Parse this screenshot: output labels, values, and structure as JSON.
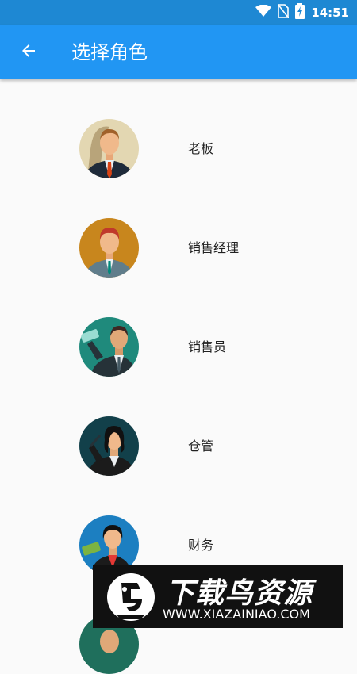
{
  "status_bar": {
    "time": "14:51",
    "icons": [
      "wifi-icon",
      "no-sim-icon",
      "battery-charging-icon"
    ]
  },
  "app_bar": {
    "title": "选择角色",
    "back_icon": "arrow-left-icon"
  },
  "roles": [
    {
      "label": "老板",
      "avatar": "boss-avatar",
      "bg": "#e3d7b2"
    },
    {
      "label": "销售经理",
      "avatar": "sales-manager-avatar",
      "bg": "#c8861d"
    },
    {
      "label": "销售员",
      "avatar": "salesperson-avatar",
      "bg": "#1f8a7c"
    },
    {
      "label": "仓管",
      "avatar": "warehouse-keeper-avatar",
      "bg": "#12404a"
    },
    {
      "label": "财务",
      "avatar": "finance-avatar",
      "bg": "#1c7fc1"
    }
  ],
  "watermark": {
    "title": "下载鸟资源",
    "url": "WWW.XIAZAINIAO.COM"
  },
  "colors": {
    "status_bar": "#1e88d3",
    "app_bar": "#2196f3",
    "background": "#fafafa"
  }
}
